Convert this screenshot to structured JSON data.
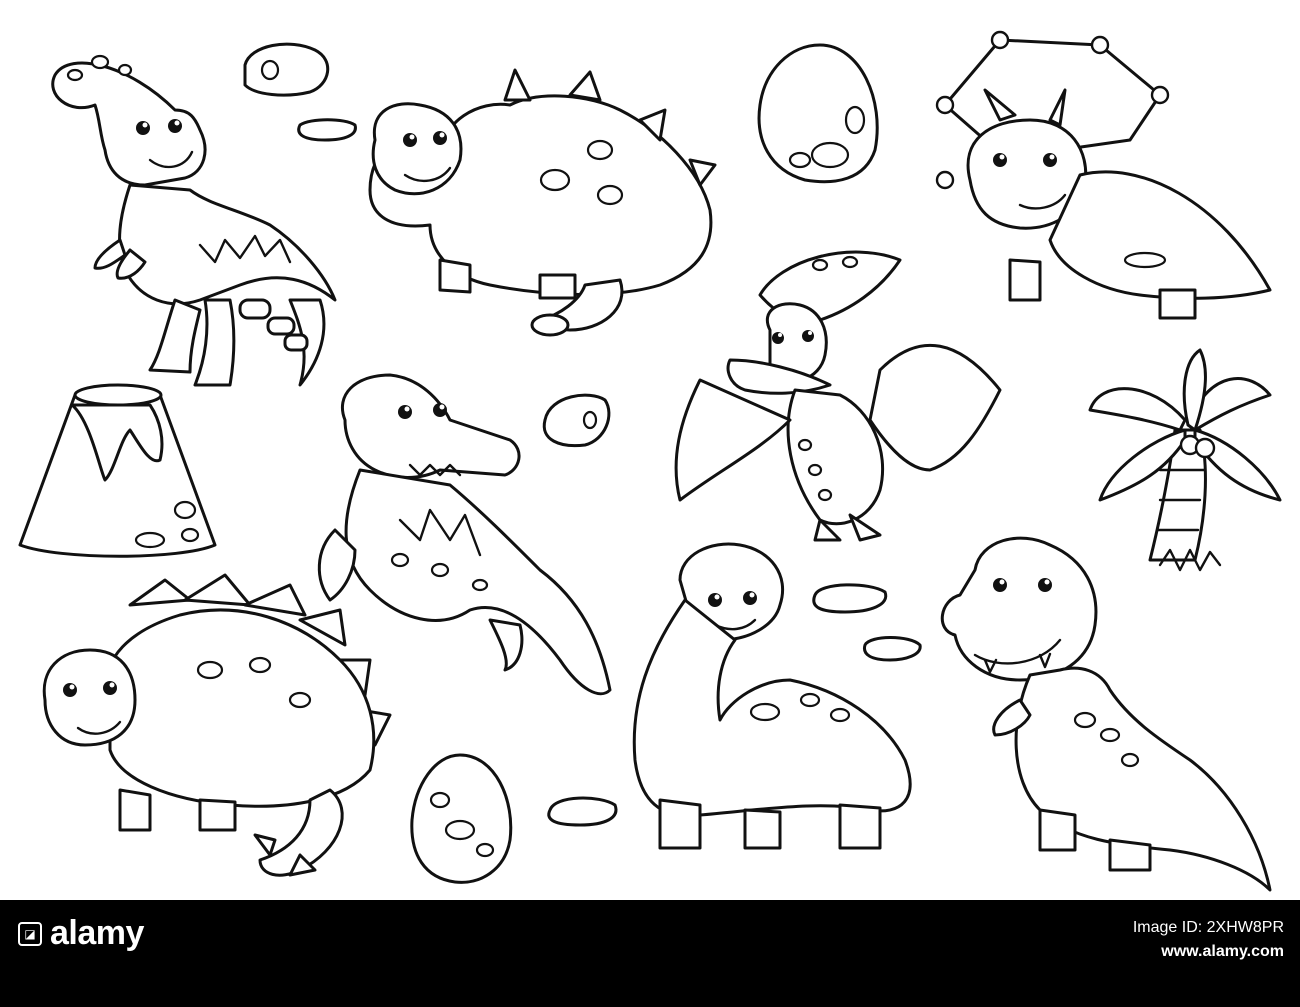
{
  "stock_footer": {
    "brand": "alamy",
    "image_id_label": "Image ID: 2XHW8PR",
    "url": "www.alamy.com"
  }
}
